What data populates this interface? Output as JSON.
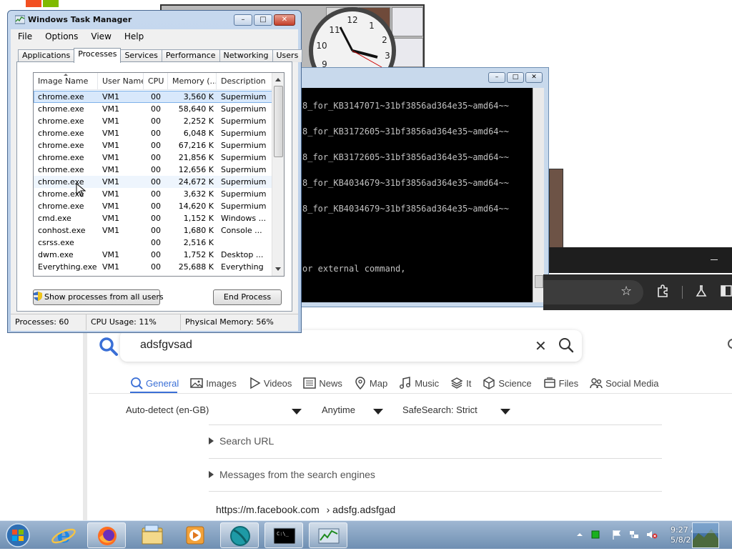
{
  "task_manager": {
    "title": "Windows Task Manager",
    "menu": [
      "File",
      "Options",
      "View",
      "Help"
    ],
    "tabs": [
      "Applications",
      "Processes",
      "Services",
      "Performance",
      "Networking",
      "Users"
    ],
    "active_tab": "Processes",
    "columns": [
      "Image Name",
      "User Name",
      "CPU",
      "Memory (...",
      "Description"
    ],
    "processes": [
      {
        "name": "chrome.exe",
        "user": "VM1",
        "cpu": "00",
        "memory": "3,560 K",
        "description": "Supermium"
      },
      {
        "name": "chrome.exe",
        "user": "VM1",
        "cpu": "00",
        "memory": "58,640 K",
        "description": "Supermium"
      },
      {
        "name": "chrome.exe",
        "user": "VM1",
        "cpu": "00",
        "memory": "2,252 K",
        "description": "Supermium"
      },
      {
        "name": "chrome.exe",
        "user": "VM1",
        "cpu": "00",
        "memory": "6,048 K",
        "description": "Supermium"
      },
      {
        "name": "chrome.exe",
        "user": "VM1",
        "cpu": "00",
        "memory": "67,216 K",
        "description": "Supermium"
      },
      {
        "name": "chrome.exe",
        "user": "VM1",
        "cpu": "00",
        "memory": "21,856 K",
        "description": "Supermium"
      },
      {
        "name": "chrome.exe",
        "user": "VM1",
        "cpu": "00",
        "memory": "12,656 K",
        "description": "Supermium"
      },
      {
        "name": "chrome.exe",
        "user": "VM1",
        "cpu": "00",
        "memory": "24,672 K",
        "description": "Supermium"
      },
      {
        "name": "chrome.exe",
        "user": "VM1",
        "cpu": "00",
        "memory": "3,632 K",
        "description": "Supermium"
      },
      {
        "name": "chrome.exe",
        "user": "VM1",
        "cpu": "00",
        "memory": "14,620 K",
        "description": "Supermium"
      },
      {
        "name": "cmd.exe",
        "user": "VM1",
        "cpu": "00",
        "memory": "1,152 K",
        "description": "Windows ..."
      },
      {
        "name": "conhost.exe",
        "user": "VM1",
        "cpu": "00",
        "memory": "1,680 K",
        "description": "Console ..."
      },
      {
        "name": "csrss.exe",
        "user": "",
        "cpu": "00",
        "memory": "2,516 K",
        "description": ""
      },
      {
        "name": "dwm.exe",
        "user": "VM1",
        "cpu": "00",
        "memory": "1,752 K",
        "description": "Desktop ..."
      },
      {
        "name": "Everything.exe",
        "user": "VM1",
        "cpu": "00",
        "memory": "25,688 K",
        "description": "Everything"
      }
    ],
    "show_all_label": "Show processes from all users",
    "end_process_label": "End Process",
    "status": {
      "processes": "Processes: 60",
      "cpu": "CPU Usage: 11%",
      "memory": "Physical Memory: 56%"
    }
  },
  "console": {
    "lines": [
      "8_for_KB3147071~31bf3856ad364e35~amd64~~",
      "8_for_KB3172605~31bf3856ad364e35~amd64~~",
      "8_for_KB3172605~31bf3856ad364e35~amd64~~",
      "8_for_KB4034679~31bf3856ad364e35~amd64~~",
      "8_for_KB4034679~31bf3856ad364e35~amd64~~",
      "or external command,"
    ]
  },
  "search": {
    "query": "adsfgvsad",
    "categories": [
      "General",
      "Images",
      "Videos",
      "News",
      "Map",
      "Music",
      "It",
      "Science",
      "Files",
      "Social Media"
    ],
    "active_category": "General",
    "filters": {
      "language": "Auto-detect (en-GB)",
      "time": "Anytime",
      "safesearch": "SafeSearch: Strict"
    },
    "expanders": [
      "Search URL",
      "Messages from the search engines"
    ],
    "result_url": "https://m.facebook.com",
    "result_path": "› adsfg.adsfgad",
    "accent_color": "#3a6fd6"
  },
  "taskbar": {
    "time": "9:27 A",
    "date": "5/8/2"
  },
  "icons": {
    "start": "windows-start-orb",
    "ie": "internet-explorer-icon",
    "firefox": "firefox-icon",
    "explorer": "folder-icon",
    "media": "media-player-icon",
    "globe": "globe-app-icon",
    "cmd": "command-prompt-icon",
    "taskmgr": "task-manager-icon"
  }
}
